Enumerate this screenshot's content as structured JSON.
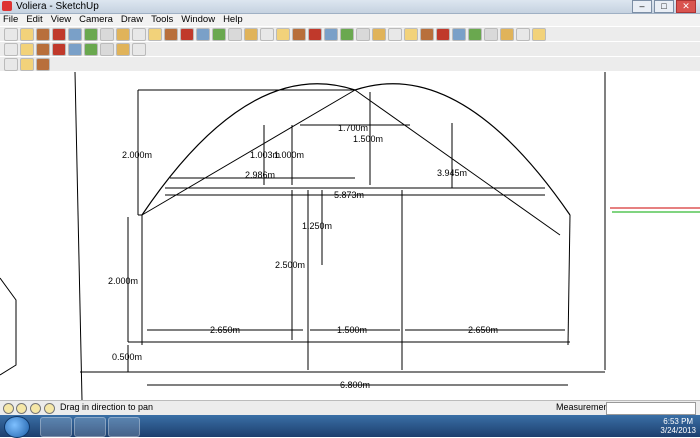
{
  "window": {
    "title": "Voliera - SketchUp"
  },
  "menu": [
    "File",
    "Edit",
    "View",
    "Camera",
    "Draw",
    "Tools",
    "Window",
    "Help"
  ],
  "toolbar_icons": [
    "select-icon",
    "pencil-icon",
    "rectangle-icon",
    "circle-icon",
    "arc-icon",
    "eraser-icon",
    "paint-icon",
    "pushpull-icon",
    "move-icon",
    "rotate-icon",
    "offset-icon",
    "followme-icon",
    "scale-icon",
    "tape-icon",
    "dimension-icon",
    "protractor-icon",
    "text-icon",
    "axes-icon",
    "3dtext-icon",
    "orbit-icon",
    "pan-icon",
    "zoom-icon",
    "zoomwindow-icon",
    "zoomextents-icon",
    "previous-icon",
    "next-icon",
    "position-camera-icon",
    "walk-icon",
    "lookaround-icon",
    "section-icon",
    "component-icon",
    "warehouse-icon",
    "share-icon",
    "extension-icon"
  ],
  "dimensions": {
    "d2000_top": "2.000m",
    "d1700": "1.700m",
    "d1500_v": "1.500m",
    "d1003": "1.003m",
    "d1000": "1.000m",
    "d2986": "2.986m",
    "d3945": "3.945m",
    "d5873": "5.873m",
    "d1250": "1.250m",
    "d2500": "2.500m",
    "d2000_mid": "2.000m",
    "d2650_l": "2.650m",
    "d1500_h": "1.500m",
    "d2650_r": "2.650m",
    "d0500": "0.500m",
    "d6800": "6.800m"
  },
  "status": {
    "text": "Drag in direction to pan",
    "measurements_label": "Measurements"
  },
  "taskbar": {
    "time": "6:53 PM",
    "date": "3/24/2013"
  }
}
